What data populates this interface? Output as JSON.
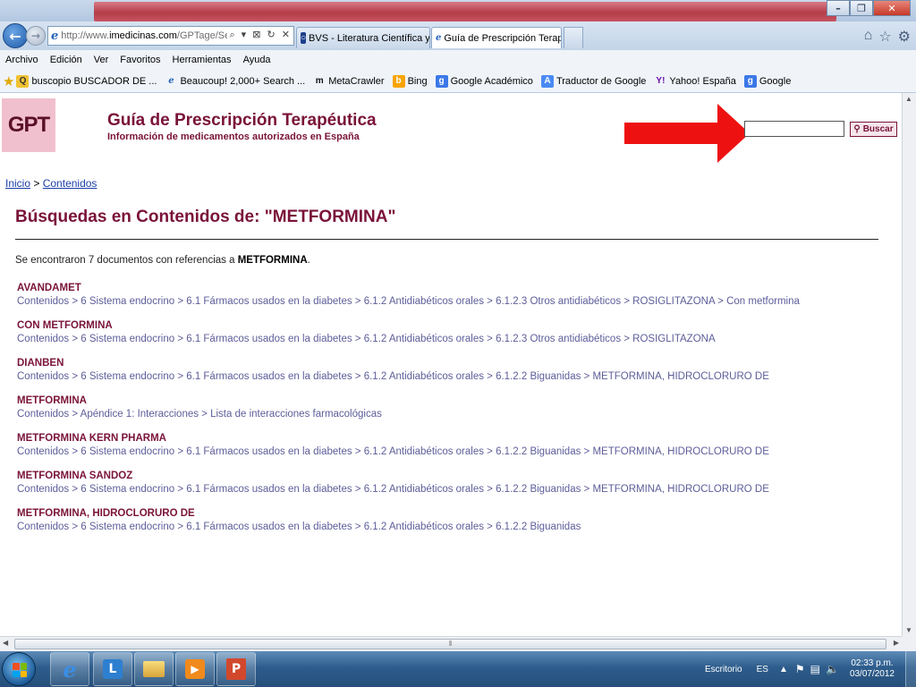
{
  "browser": {
    "address_url_prefix": "http://www.",
    "address_url_domain": "imedicinas.com",
    "address_url_rest": "/GPTage/Search.ph",
    "address_tools": "⌕ ▾ ⊠ ↻ ✕",
    "tabs": [
      {
        "label": "BVS - Literatura Científica y Té...",
        "icon": "bvs-icon"
      },
      {
        "label": "Guía de Prescripción Terapé...",
        "icon": "ie-page-icon",
        "active": true
      }
    ],
    "menu": [
      "Archivo",
      "Edición",
      "Ver",
      "Favoritos",
      "Herramientas",
      "Ayuda"
    ],
    "favorites": [
      {
        "label": "buscopio BUSCADOR DE ...",
        "icon": "buscopio-icon"
      },
      {
        "label": "Beaucoup! 2,000+ Search ...",
        "icon": "ie-page-icon"
      },
      {
        "label": "MetaCrawler",
        "icon": "metacrawler-icon"
      },
      {
        "label": "Bing",
        "icon": "bing-icon"
      },
      {
        "label": "Google Académico",
        "icon": "google-icon"
      },
      {
        "label": "Traductor de Google",
        "icon": "translate-icon"
      },
      {
        "label": "Yahoo! España",
        "icon": "yahoo-icon"
      },
      {
        "label": "Google",
        "icon": "google-icon"
      }
    ]
  },
  "site": {
    "logo_text": "GPT",
    "title": "Guía de Prescripción Terapéutica",
    "subtitle": "Información de medicamentos autorizados en España",
    "search_button": "Buscar",
    "search_value": ""
  },
  "breadcrumb": {
    "home": "Inicio",
    "separator": ">",
    "current": "Contenidos"
  },
  "results": {
    "heading": "Búsquedas en Contenidos de: \"METFORMINA\"",
    "found_prefix": "Se encontraron 7 documentos con referencias a ",
    "found_term": "METFORMINA",
    "found_suffix": ".",
    "items": [
      {
        "title": "AVANDAMET",
        "path": "Contenidos > 6 Sistema endocrino > 6.1 Fármacos usados en la diabetes > 6.1.2 Antidiabéticos orales > 6.1.2.3 Otros antidiabéticos > ROSIGLITAZONA > Con metformina"
      },
      {
        "title": "CON METFORMINA",
        "path": "Contenidos > 6 Sistema endocrino > 6.1 Fármacos usados en la diabetes > 6.1.2 Antidiabéticos orales > 6.1.2.3 Otros antidiabéticos > ROSIGLITAZONA"
      },
      {
        "title": "DIANBEN",
        "path": "Contenidos > 6 Sistema endocrino > 6.1 Fármacos usados en la diabetes > 6.1.2 Antidiabéticos orales > 6.1.2.2 Biguanidas > METFORMINA, HIDROCLORURO DE"
      },
      {
        "title": "METFORMINA",
        "path": "Contenidos > Apéndice 1: Interacciones > Lista de interacciones farmacológicas"
      },
      {
        "title": "METFORMINA KERN PHARMA",
        "path": "Contenidos > 6 Sistema endocrino > 6.1 Fármacos usados en la diabetes > 6.1.2 Antidiabéticos orales > 6.1.2.2 Biguanidas > METFORMINA, HIDROCLORURO DE"
      },
      {
        "title": "METFORMINA SANDOZ",
        "path": "Contenidos > 6 Sistema endocrino > 6.1 Fármacos usados en la diabetes > 6.1.2 Antidiabéticos orales > 6.1.2.2 Biguanidas > METFORMINA, HIDROCLORURO DE"
      },
      {
        "title": "METFORMINA, HIDROCLORURO DE",
        "path": "Contenidos > 6 Sistema endocrino > 6.1 Fármacos usados en la diabetes > 6.1.2 Antidiabéticos orales > 6.1.2.2 Biguanidas"
      }
    ]
  },
  "taskbar": {
    "apps": [
      "internet-explorer-icon",
      "lync-icon",
      "file-explorer-icon",
      "media-player-icon",
      "powerpoint-icon"
    ],
    "desktop_label": "Escritorio",
    "language": "ES",
    "time": "02:33 p.m.",
    "date": "03/07/2012"
  },
  "colors": {
    "brand": "#7a1339",
    "path_text": "#5d5d9a",
    "annotation_arrow": "#ee1111"
  }
}
